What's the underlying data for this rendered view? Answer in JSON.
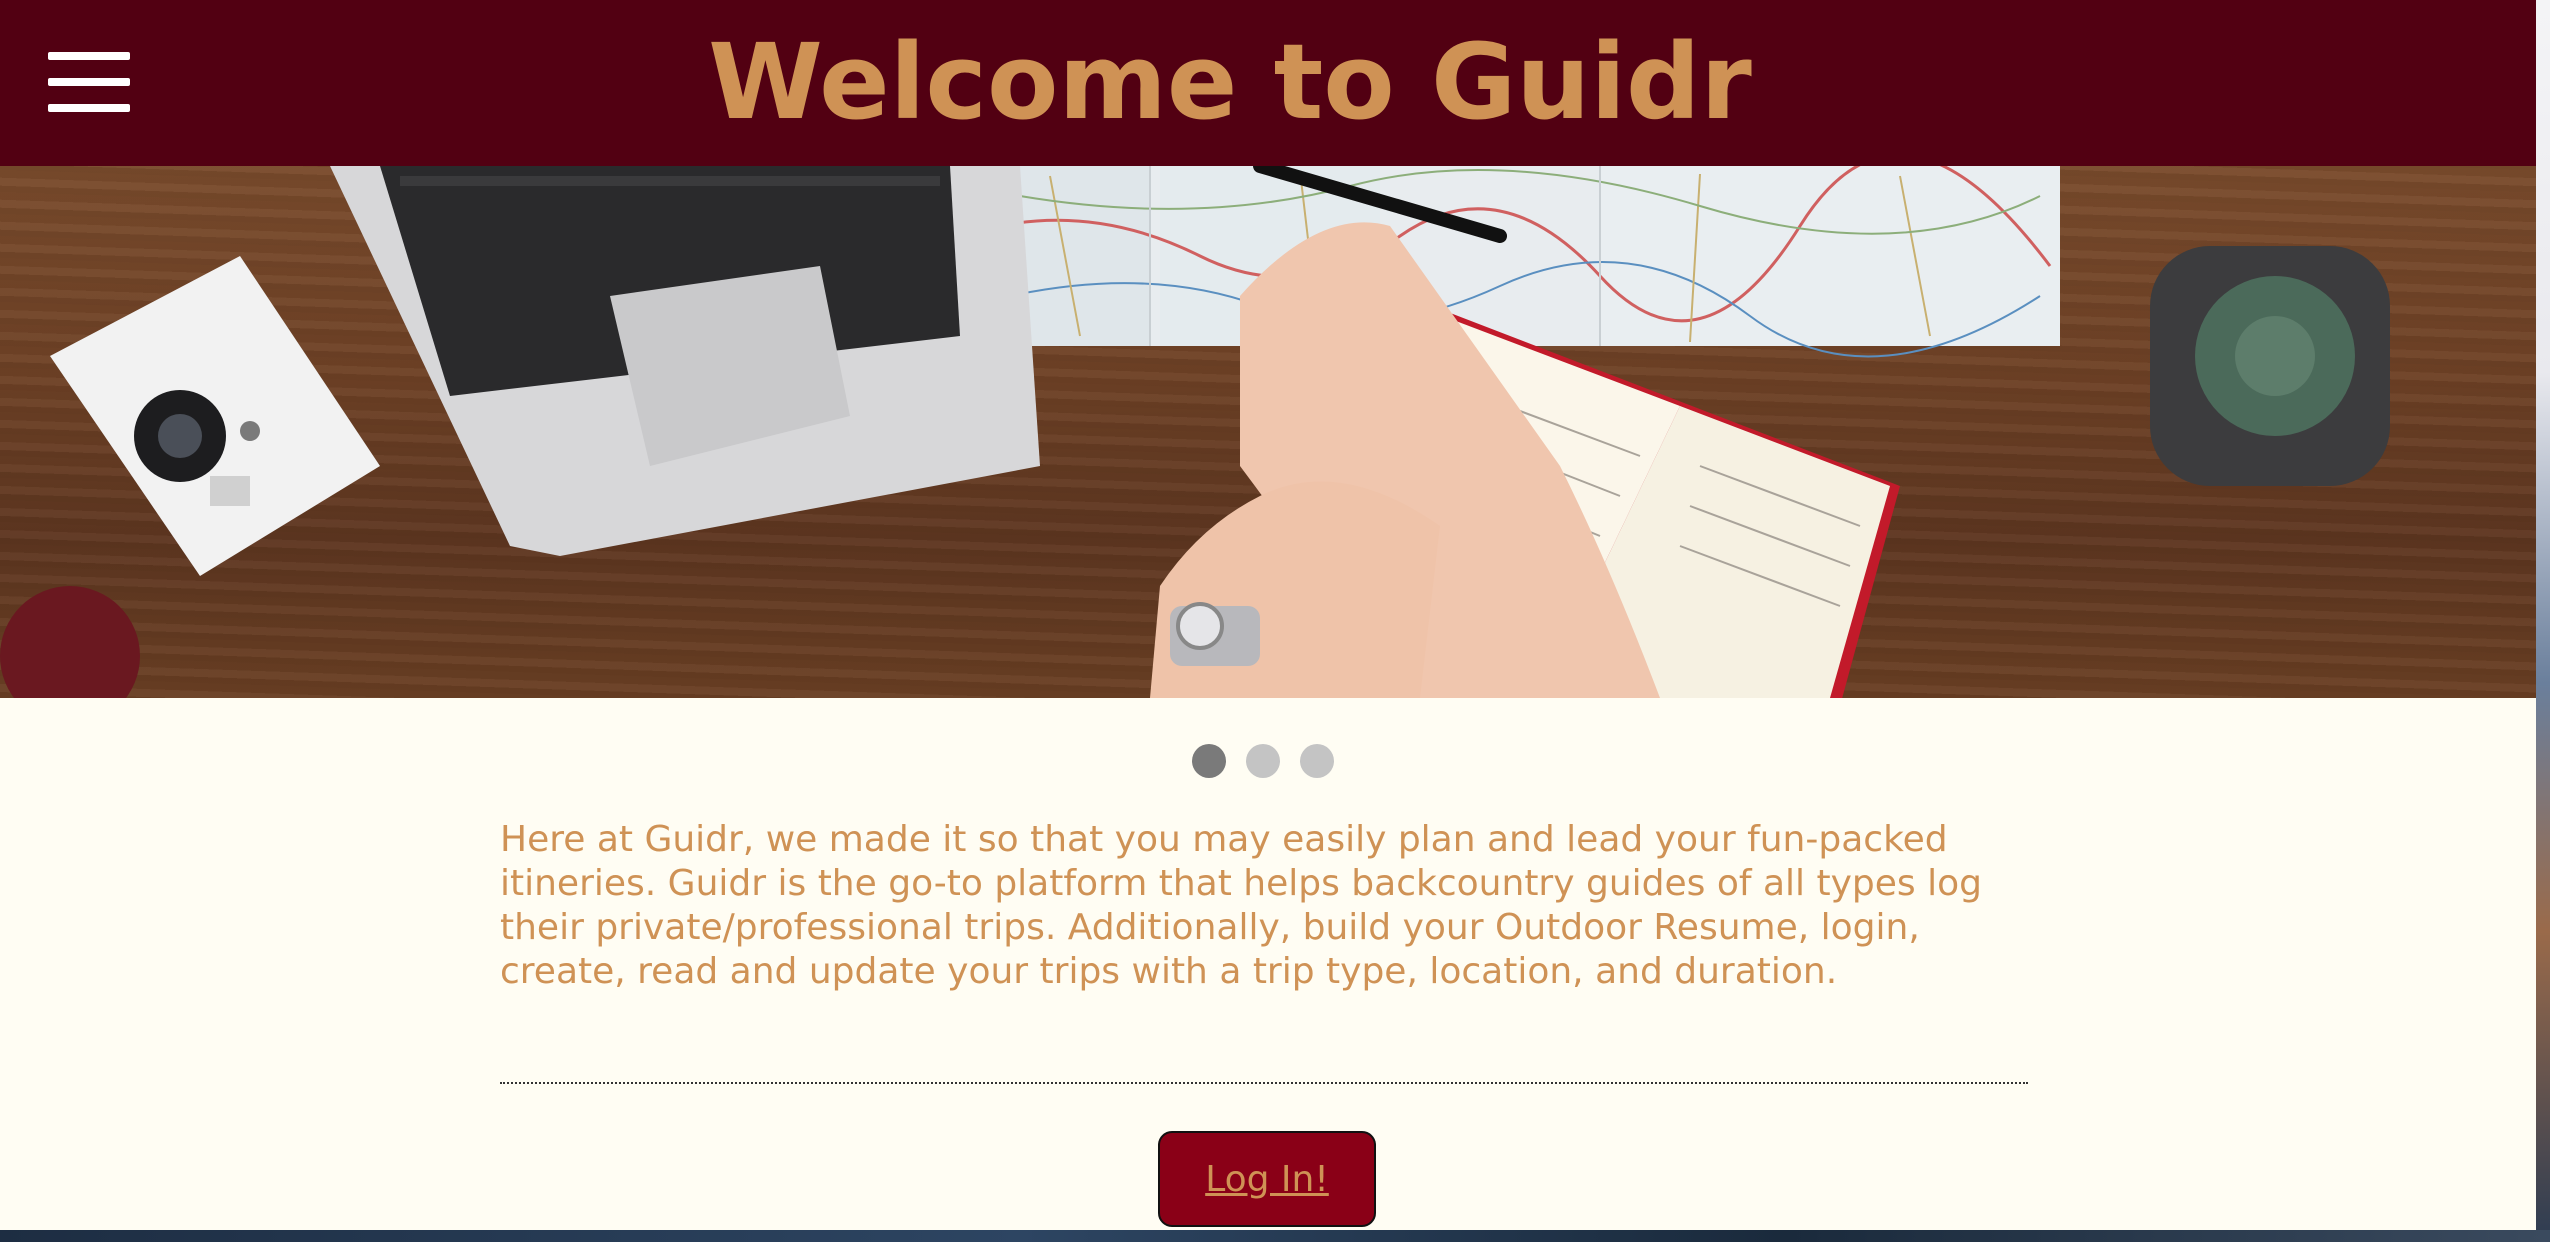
{
  "header": {
    "title": "Welcome to Guidr",
    "menu_icon": "hamburger-menu-icon"
  },
  "hero": {
    "image": "desk-with-laptop-map-notebook-camera-cactus"
  },
  "carousel": {
    "slide_count": 3,
    "active_index": 0
  },
  "main": {
    "intro_text": "Here at Guidr, we made it so that you may easily plan and lead your fun-packed itineries. Guidr is the go-to platform that helps backcountry guides of all types log their private/professional trips. Additionally, build your Outdoor Resume, login, create, read and update your trips with a trip type, location, and duration.",
    "login_label": "Log In!"
  },
  "colors": {
    "header_bg": "#520012",
    "accent_text": "#cf9255",
    "page_bg": "#fffdf3",
    "button_bg": "#8a0017"
  }
}
